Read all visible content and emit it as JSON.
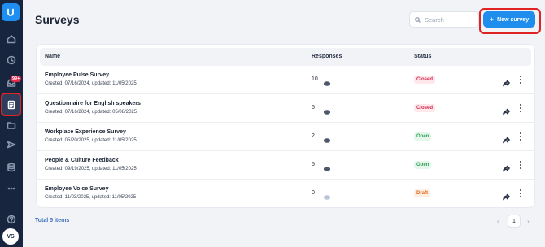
{
  "header": {
    "title": "Surveys",
    "search_placeholder": "Search",
    "new_button_label": "New survey",
    "new_button_icon": "+"
  },
  "sidebar": {
    "badge": "99+",
    "avatar": "VS",
    "items": [
      "home-icon",
      "clock-icon",
      "inbox-icon",
      "survey-icon",
      "folder-icon",
      "send-icon",
      "database-icon",
      "more-icon",
      "help-icon"
    ]
  },
  "table": {
    "columns": [
      "Name",
      "Responses",
      "Status"
    ],
    "rows": [
      {
        "title": "Employee Pulse Survey",
        "meta": "Created: 07/16/2024, updated: 11/05/2025",
        "responses": "10",
        "status": "Closed"
      },
      {
        "title": "Questionnaire for English speakers",
        "meta": "Created: 07/16/2024, updated: 05/08/2025",
        "responses": "5",
        "status": "Closed"
      },
      {
        "title": "Workplace Experience Survey",
        "meta": "Created: 05/20/2025, updated: 11/05/2025",
        "responses": "2",
        "status": "Open"
      },
      {
        "title": "People & Culture Feedback",
        "meta": "Created: 09/19/2025, updated: 11/05/2025",
        "responses": "5",
        "status": "Open"
      },
      {
        "title": "Employee Voice Survey",
        "meta": "Created: 11/03/2025, updated: 11/05/2025",
        "responses": "0",
        "status": "Draft"
      }
    ]
  },
  "footer": {
    "total": "Total 5 items",
    "current_page": "1",
    "prev": "‹",
    "next": "›"
  },
  "colors": {
    "sidebar_bg": "#18253f",
    "accent": "#1f8ded",
    "highlight": "#e02424"
  }
}
